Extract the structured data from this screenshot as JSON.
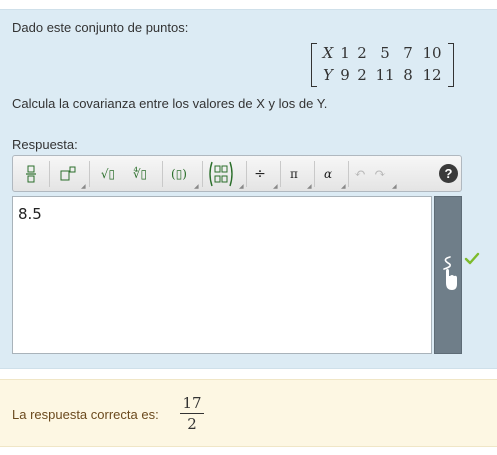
{
  "question": {
    "prompt": "Dado este conjunto de puntos:",
    "matrix": {
      "row_x_label": "X",
      "row_x_values": [
        "1",
        "2",
        "5",
        "7",
        "10"
      ],
      "row_y_label": "Y",
      "row_y_values": [
        "9",
        "2",
        "11",
        "8",
        "12"
      ]
    },
    "instruction": "Calcula la covarianza entre los valores de X y los de Y."
  },
  "answer_area": {
    "label": "Respuesta:",
    "value": "8.5",
    "status": "correct",
    "status_color": "#7dbb2c"
  },
  "toolbar": {
    "buttons": [
      {
        "name": "fraction-button",
        "icon": "fraction-icon"
      },
      {
        "name": "superscript-button",
        "icon": "superscript-icon"
      },
      {
        "name": "sqrt-button",
        "glyph": "√▯",
        "icon": "square-root-icon"
      },
      {
        "name": "nth-root-button",
        "glyph": "∜▯",
        "icon": "nth-root-icon"
      },
      {
        "name": "parentheses-button",
        "glyph": "(▯)",
        "icon": "parentheses-icon"
      },
      {
        "name": "matrix-button",
        "icon": "matrix-icon"
      },
      {
        "name": "divide-button",
        "glyph": "÷",
        "icon": "divide-icon"
      },
      {
        "name": "pi-button",
        "glyph": "π",
        "icon": "pi-icon"
      },
      {
        "name": "alpha-button",
        "glyph": "α",
        "icon": "alpha-icon"
      },
      {
        "name": "undo-button",
        "glyph": "↶",
        "icon": "undo-icon"
      },
      {
        "name": "redo-button",
        "glyph": "↷",
        "icon": "redo-icon"
      }
    ],
    "help_label": "?"
  },
  "feedback": {
    "label": "La respuesta correcta es:",
    "numerator": "17",
    "denominator": "2"
  },
  "colors": {
    "question_bg": "#dcebf4",
    "feedback_bg": "#fdf7e3",
    "feedback_text": "#6b4a1e",
    "toolbar_icon": "#2a6e2a",
    "hand_panel": "#6f7e89"
  }
}
